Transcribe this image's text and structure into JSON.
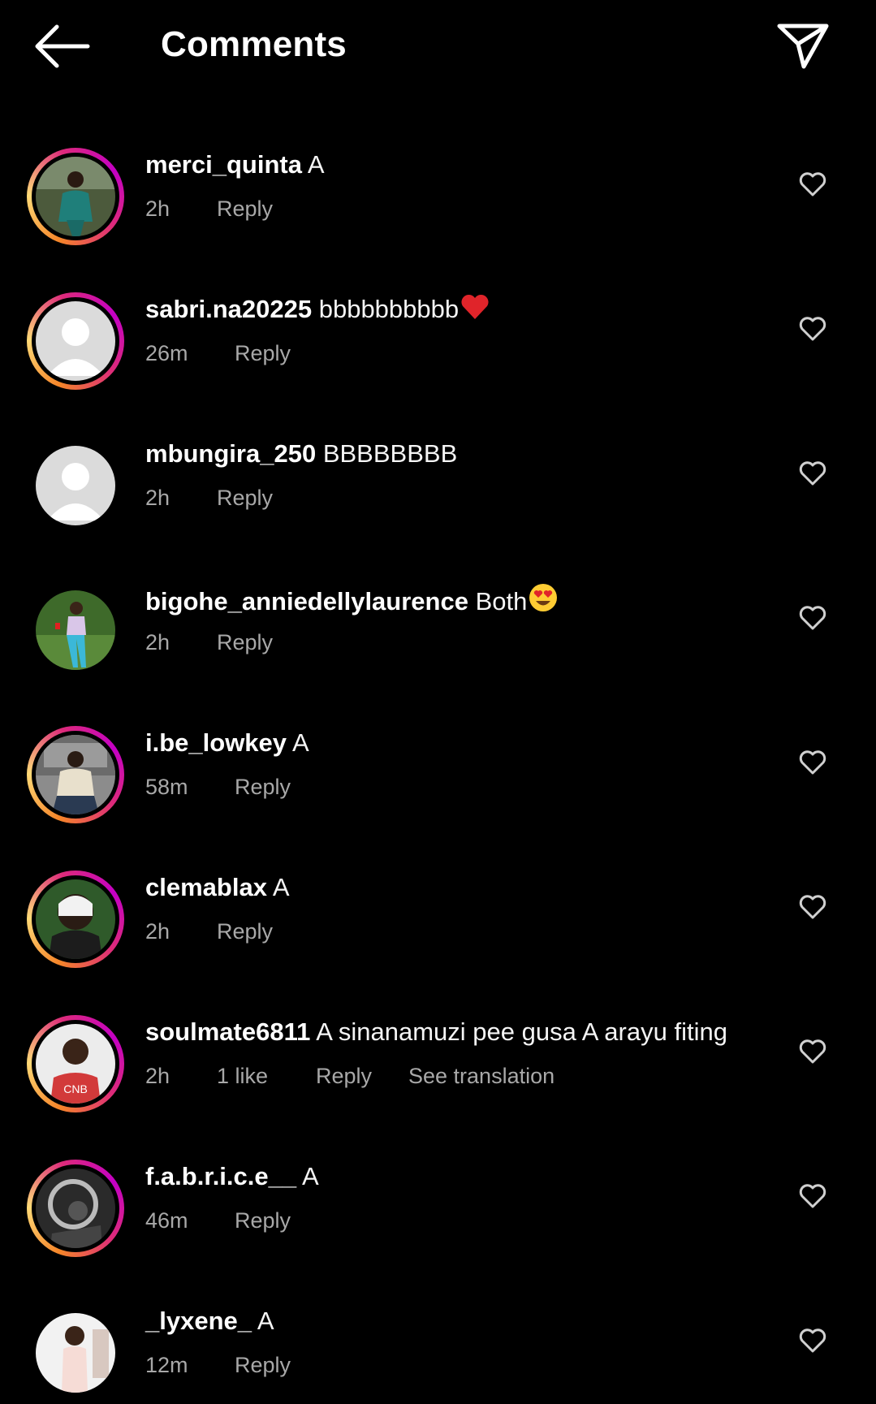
{
  "header": {
    "title": "Comments",
    "back_icon": "arrow-left-icon",
    "share_icon": "paper-plane-icon"
  },
  "colors": {
    "background": "#000000",
    "text": "#ffffff",
    "meta": "#a8a8a8",
    "story_ring_start": "#f58529",
    "story_ring_end": "#c400c4"
  },
  "comments": [
    {
      "username": "merci_quinta",
      "text": "A",
      "emoji": "",
      "time": "2h",
      "likes": "",
      "reply": "Reply",
      "translation": "",
      "story_ring": true,
      "avatar_type": "photo"
    },
    {
      "username": "sabri.na20225",
      "text": "bbbbbbbbbb",
      "emoji": "red-heart-emoji",
      "time": "26m",
      "likes": "",
      "reply": "Reply",
      "translation": "",
      "story_ring": true,
      "avatar_type": "default"
    },
    {
      "username": "mbungira_250",
      "text": "BBBBBBBB",
      "emoji": "",
      "time": "2h",
      "likes": "",
      "reply": "Reply",
      "translation": "",
      "story_ring": false,
      "avatar_type": "default"
    },
    {
      "username": "bigohe_anniedellylaurence",
      "text": "Both",
      "emoji": "heart-eyes-emoji",
      "time": "2h",
      "likes": "",
      "reply": "Reply",
      "translation": "",
      "story_ring": false,
      "avatar_type": "photo"
    },
    {
      "username": "i.be_lowkey",
      "text": "A",
      "emoji": "",
      "time": "58m",
      "likes": "",
      "reply": "Reply",
      "translation": "",
      "story_ring": true,
      "avatar_type": "photo"
    },
    {
      "username": "clemablax",
      "text": "A",
      "emoji": "",
      "time": "2h",
      "likes": "",
      "reply": "Reply",
      "translation": "",
      "story_ring": true,
      "avatar_type": "photo"
    },
    {
      "username": "soulmate6811",
      "text": "A sinanamuzi pee gusa A arayu fiting",
      "emoji": "",
      "time": "2h",
      "likes": "1 like",
      "reply": "Reply",
      "translation": "See translation",
      "story_ring": true,
      "avatar_type": "photo"
    },
    {
      "username": "f.a.b.r.i.c.e__",
      "text": "A",
      "emoji": "",
      "time": "46m",
      "likes": "",
      "reply": "Reply",
      "translation": "",
      "story_ring": true,
      "avatar_type": "photo"
    },
    {
      "username": "_lyxene_",
      "text": "A",
      "emoji": "",
      "time": "12m",
      "likes": "",
      "reply": "Reply",
      "translation": "",
      "story_ring": false,
      "avatar_type": "photo"
    }
  ]
}
